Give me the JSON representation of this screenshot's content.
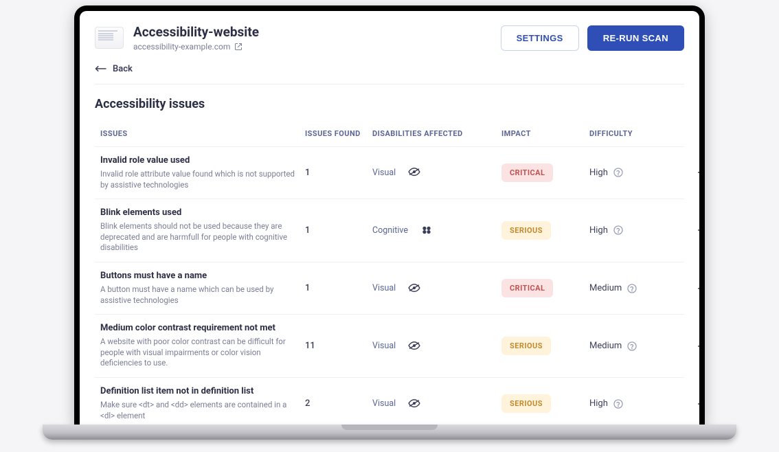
{
  "header": {
    "title": "Accessibility-website",
    "site_url": "accessibility-example.com",
    "settings_label": "SETTINGS",
    "rerun_label": "RE-RUN SCAN",
    "back_label": "Back"
  },
  "section": {
    "title": "Accessibility issues"
  },
  "columns": {
    "issues": "ISSUES",
    "found": "ISSUES FOUND",
    "disabilities": "DISABILITIES AFFECTED",
    "impact": "IMPACT",
    "difficulty": "DIFFICULTY"
  },
  "impact_labels": {
    "critical": "CRITICAL",
    "serious": "SERIOUS"
  },
  "rows": [
    {
      "title": "Invalid role value used",
      "desc": "Invalid role attribute value found which is not supported by assistive technologies",
      "count": "1",
      "disability": "Visual",
      "disability_icon": "eye",
      "impact": "critical",
      "difficulty": "High"
    },
    {
      "title": "Blink elements used",
      "desc": "Blink elements should not be used because they are deprecated and are harmfull for people with cognitive disabilities",
      "count": "1",
      "disability": "Cognitive",
      "disability_icon": "brain",
      "impact": "serious",
      "difficulty": "High"
    },
    {
      "title": "Buttons must have a name",
      "desc": "A button must have a name which can be used by assistive technologies",
      "count": "1",
      "disability": "Visual",
      "disability_icon": "eye",
      "impact": "critical",
      "difficulty": "Medium"
    },
    {
      "title": "Medium color contrast requirement not met",
      "desc": "A website with poor color contrast can be difficult for people with visual impairments or color vision deficiencies to use.",
      "count": "11",
      "disability": "Visual",
      "disability_icon": "eye",
      "impact": "serious",
      "difficulty": "Medium"
    },
    {
      "title": "Definition list item not in definition list",
      "desc": "Make sure <dt> and <dd> elements are contained in a <dl> element",
      "count": "2",
      "disability": "Visual",
      "disability_icon": "eye",
      "impact": "serious",
      "difficulty": "High"
    }
  ]
}
